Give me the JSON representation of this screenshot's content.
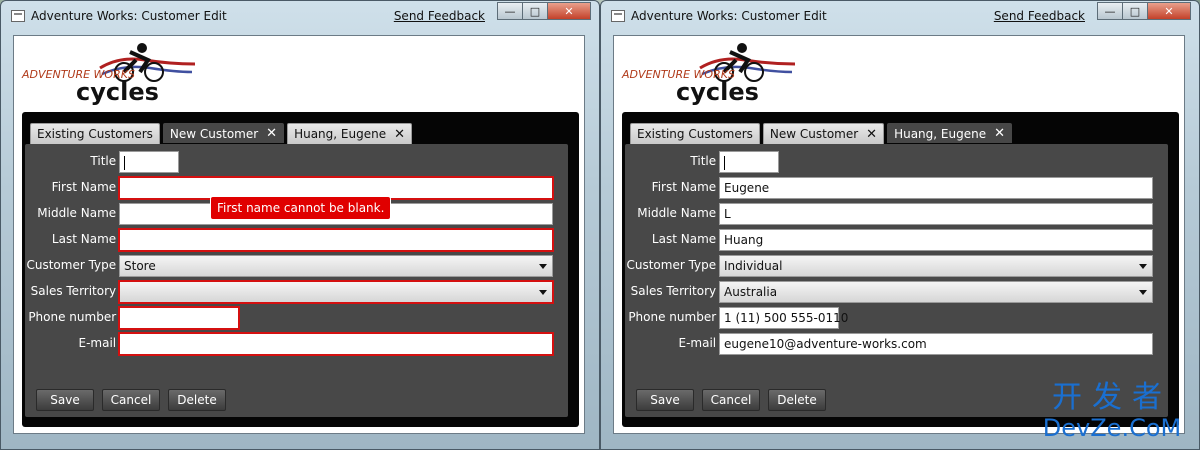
{
  "window_title": "Adventure Works: Customer Edit",
  "feedback_link": "Send Feedback",
  "window_buttons": {
    "minimize": "—",
    "maximize": "□",
    "close": "✕"
  },
  "logo": {
    "line1": "ADVENTURE WORKS",
    "line2": "cycles"
  },
  "tabs": [
    {
      "label": "Existing Customers",
      "closable": false
    },
    {
      "label": "New Customer",
      "closable": true
    },
    {
      "label": "Huang, Eugene",
      "closable": true
    }
  ],
  "labels": {
    "title": "Title :",
    "first_name": "First Name :",
    "middle_name": "Middle Name :",
    "last_name": "Last Name :",
    "customer_type": "Customer Type :",
    "sales_territory": "Sales Territory :",
    "phone": "Phone number :",
    "email": "E-mail :"
  },
  "buttons": {
    "save": "Save",
    "cancel": "Cancel",
    "delete": "Delete"
  },
  "left_form": {
    "active_tab": "New Customer",
    "title": "",
    "first_name": "",
    "middle_name": "",
    "last_name": "",
    "customer_type": "Store",
    "sales_territory": "",
    "phone": "",
    "email": "",
    "error_tooltip": "First name cannot be blank."
  },
  "right_form": {
    "active_tab": "Huang, Eugene",
    "title": "",
    "first_name": "Eugene",
    "middle_name": "L",
    "last_name": "Huang",
    "customer_type": "Individual",
    "sales_territory": "Australia",
    "phone": "1 (11) 500 555-0110",
    "email": "eugene10@adventure-works.com"
  },
  "watermark": {
    "top": "开发者",
    "bottom": "DevZe.CoM"
  },
  "colors": {
    "error": "#e00000",
    "panel": "#484848",
    "watermark": "#1a6fd0"
  }
}
